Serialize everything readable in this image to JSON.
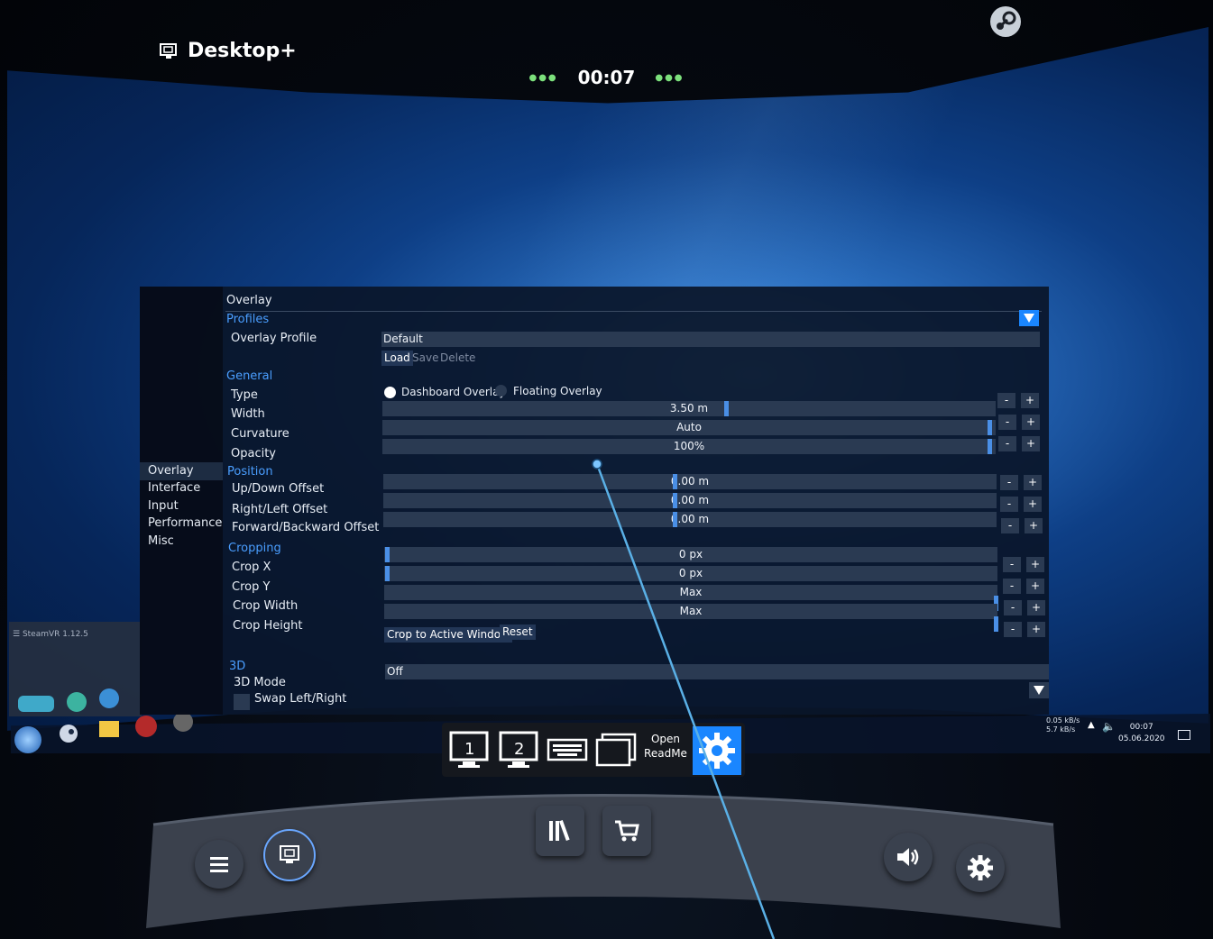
{
  "header": {
    "app_title": "Desktop+",
    "timer": "00:07"
  },
  "desktop": {
    "steamvr_window_title": "SteamVR 1.12.5",
    "tray_time": "00:07",
    "tray_date": "05.06.2020",
    "net_up": "0.05 kB/s",
    "net_down": "5.7 kB/s"
  },
  "sidebar": {
    "items": [
      {
        "label": "Overlay",
        "active": true
      },
      {
        "label": "Interface"
      },
      {
        "label": "Input"
      },
      {
        "label": "Performance"
      },
      {
        "label": "Misc"
      }
    ]
  },
  "settings": {
    "page_title": "Overlay",
    "profiles": {
      "section": "Profiles",
      "profile_label": "Overlay Profile",
      "profile_value": "Default",
      "load": "Load",
      "save": "Save",
      "delete": "Delete"
    },
    "general": {
      "section": "General",
      "type_label": "Type",
      "type_option_dashboard": "Dashboard Overlay",
      "type_option_floating": "Floating Overlay",
      "type_selected": "Dashboard Overlay",
      "width_label": "Width",
      "width_value": "3.50 m",
      "curvature_label": "Curvature",
      "curvature_value": "Auto",
      "opacity_label": "Opacity",
      "opacity_value": "100%"
    },
    "position": {
      "section": "Position",
      "updown_label": "Up/Down Offset",
      "updown_value": "0.00 m",
      "rightleft_label": "Right/Left Offset",
      "rightleft_value": "0.00 m",
      "forward_label": "Forward/Backward Offset",
      "forward_value": "0.00 m"
    },
    "cropping": {
      "section": "Cropping",
      "cropx_label": "Crop X",
      "cropx_value": "0 px",
      "cropy_label": "Crop Y",
      "cropy_value": "0 px",
      "cropw_label": "Crop Width",
      "cropw_value": "Max",
      "croph_label": "Crop Height",
      "croph_value": "Max",
      "crop_active": "Crop to Active Window",
      "reset": "Reset"
    },
    "threed": {
      "section": "3D",
      "mode_label": "3D Mode",
      "mode_value": "Off",
      "swap_label": "Swap Left/Right"
    },
    "minus": "-",
    "plus": "+"
  },
  "toolbar": {
    "monitor1": "1",
    "monitor2": "2",
    "readme_line1": "Open",
    "readme_line2": "ReadMe"
  },
  "colors": {
    "accent": "#1a86ff",
    "section_header": "#4a9eff",
    "slider_bg": "#2a3a52",
    "slider_knob": "#4a8fe6",
    "timer_dots": "#7ce07c",
    "laser": "#5ab0e6"
  }
}
